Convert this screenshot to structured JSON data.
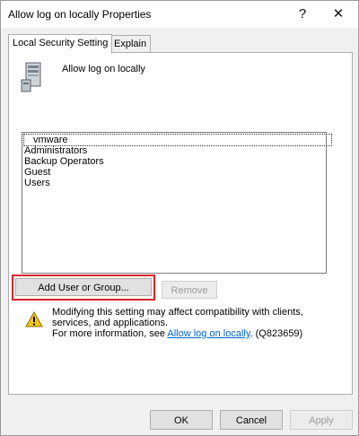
{
  "window": {
    "title": "Allow log on locally Properties",
    "help": "?",
    "close": "✕"
  },
  "tabs": [
    {
      "label": "Local Security Setting"
    },
    {
      "label": "Explain"
    }
  ],
  "policy": {
    "name": "Allow log on locally"
  },
  "list": {
    "items": [
      "vmware",
      "Administrators",
      "Backup Operators",
      "Guest",
      "Users"
    ]
  },
  "buttons": {
    "add": "Add User or Group...",
    "remove": "Remove",
    "ok": "OK",
    "cancel": "Cancel",
    "apply": "Apply"
  },
  "warning": {
    "line1": "Modifying this setting may affect compatibility with clients, services, and applications.",
    "more_prefix": "For more information, see ",
    "link": "Allow log on locally",
    "suffix": ". (Q823659)"
  },
  "colors": {
    "highlight": "#d9232d",
    "link": "#0066cc",
    "accent": "#0078d7"
  }
}
